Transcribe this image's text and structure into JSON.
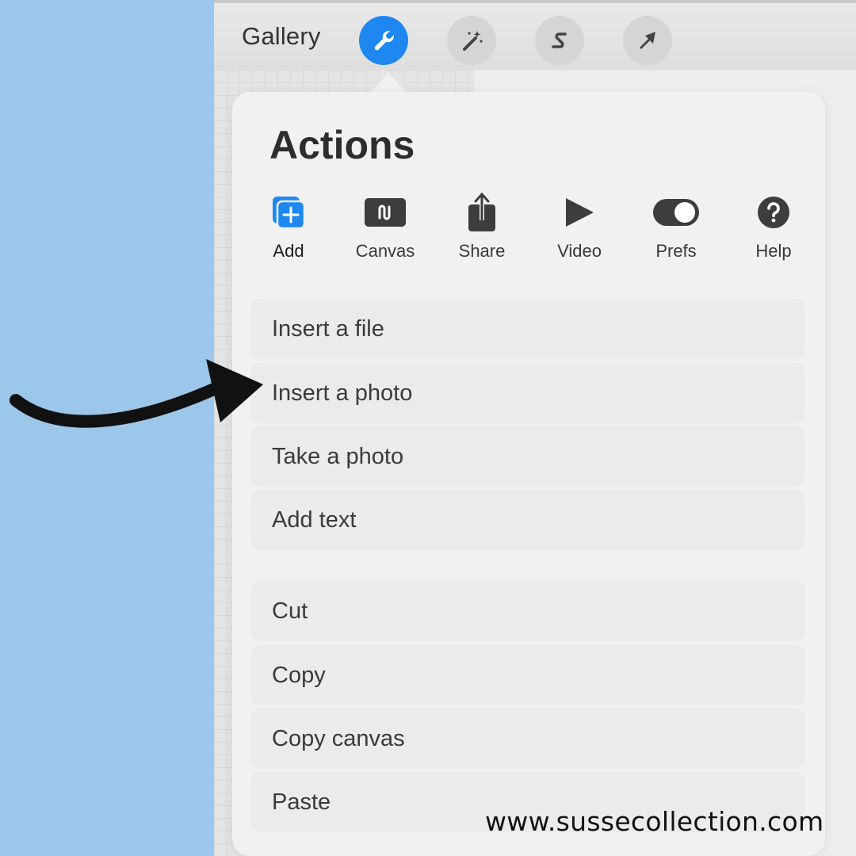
{
  "toolbar": {
    "gallery_label": "Gallery",
    "tools": [
      {
        "icon": "wrench-icon",
        "active": true
      },
      {
        "icon": "magic-wand-icon",
        "active": false
      },
      {
        "icon": "s-curve-icon",
        "active": false
      },
      {
        "icon": "arrow-cursor-icon",
        "active": false
      }
    ]
  },
  "panel": {
    "title": "Actions",
    "tabs": [
      {
        "label": "Add",
        "icon": "add-layers-icon",
        "active": true
      },
      {
        "label": "Canvas",
        "icon": "canvas-icon",
        "active": false
      },
      {
        "label": "Share",
        "icon": "share-icon",
        "active": false
      },
      {
        "label": "Video",
        "icon": "play-icon",
        "active": false
      },
      {
        "label": "Prefs",
        "icon": "toggle-icon",
        "active": false
      },
      {
        "label": "Help",
        "icon": "question-icon",
        "active": false
      }
    ],
    "items": [
      {
        "label": "Insert a file"
      },
      {
        "label": "Insert a photo"
      },
      {
        "label": "Take a photo"
      },
      {
        "label": "Add text"
      },
      {
        "label": "Cut"
      },
      {
        "label": "Copy"
      },
      {
        "label": "Copy canvas"
      },
      {
        "label": "Paste"
      }
    ]
  },
  "watermark": "www.sussecollection.com",
  "colors": {
    "background": "#9dc7ea",
    "accent": "#1e88f0",
    "panel": "#f1f1f1",
    "item": "#ebebeb"
  }
}
